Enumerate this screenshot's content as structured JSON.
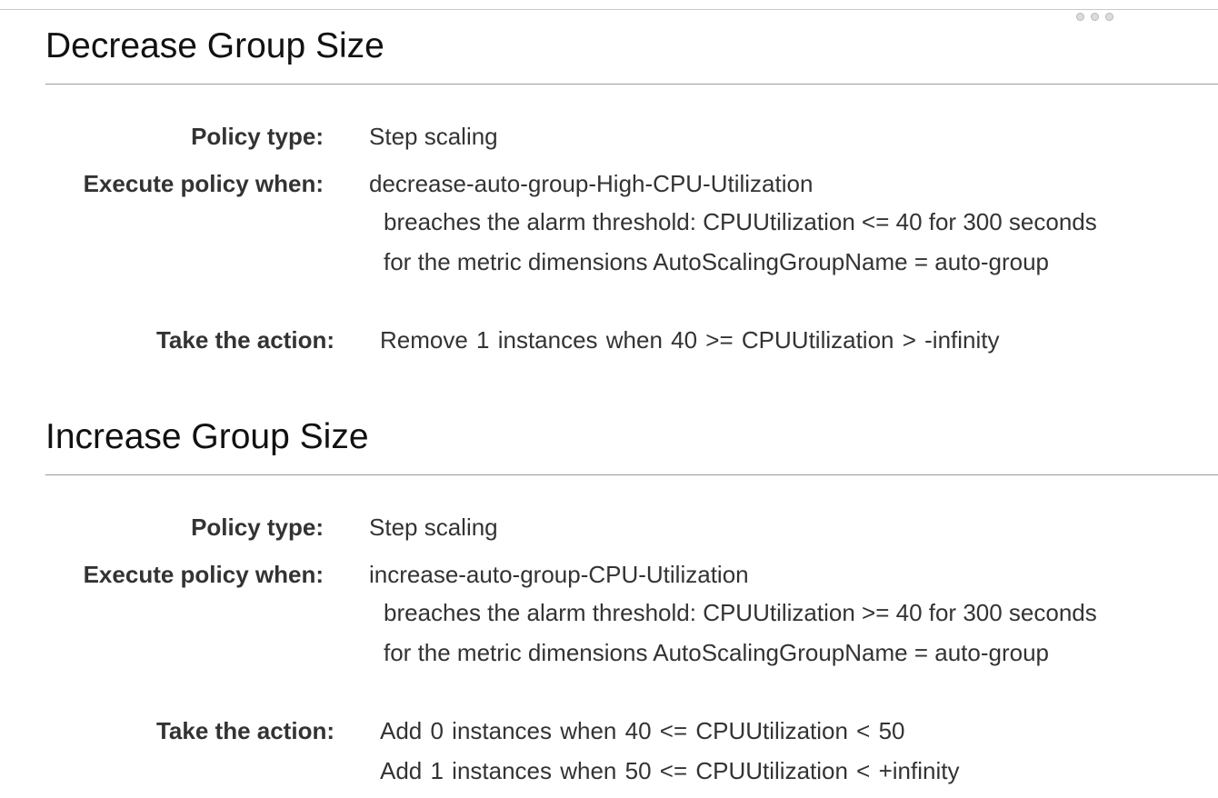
{
  "menu": {
    "icon": "more-dots-icon"
  },
  "sections": [
    {
      "title": "Decrease Group Size",
      "policy_type_label": "Policy type:",
      "policy_type_value": "Step scaling",
      "execute_label": "Execute policy when:",
      "alarm_name": "decrease-auto-group-High-CPU-Utilization",
      "threshold_line": "breaches the alarm threshold: CPUUtilization <= 40 for 300 seconds",
      "dimensions_line": "for the metric dimensions AutoScalingGroupName = auto-group",
      "action_label": "Take the action:",
      "actions": [
        "Remove 1 instances when 40 >= CPUUtilization > -infinity"
      ]
    },
    {
      "title": "Increase Group Size",
      "policy_type_label": "Policy type:",
      "policy_type_value": "Step scaling",
      "execute_label": "Execute policy when:",
      "alarm_name": "increase-auto-group-CPU-Utilization",
      "threshold_line": "breaches the alarm threshold: CPUUtilization >= 40 for 300 seconds",
      "dimensions_line": "for the metric dimensions AutoScalingGroupName = auto-group",
      "action_label": "Take the action:",
      "actions": [
        "Add 0 instances when 40 <= CPUUtilization < 50",
        "Add 1 instances when 50 <= CPUUtilization < +infinity"
      ]
    }
  ]
}
